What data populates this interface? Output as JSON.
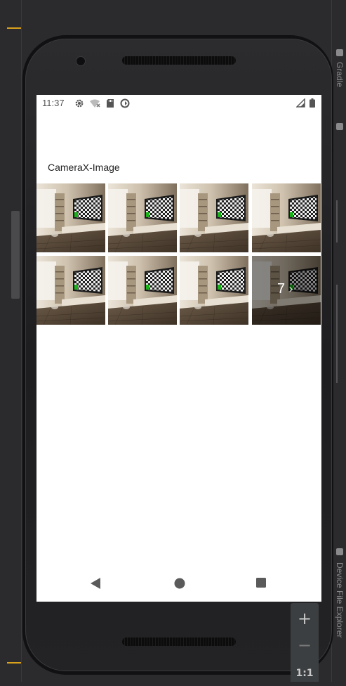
{
  "status_bar": {
    "time": "11:37",
    "left_icons": [
      "gear-icon",
      "wifi-off-icon",
      "sd-card-icon",
      "sync-icon"
    ],
    "right_icons": [
      "signal-icon",
      "battery-icon"
    ]
  },
  "app": {
    "title": "CameraX-Image"
  },
  "gallery": {
    "thumbnail_count": 8,
    "more_count": "7",
    "more_chevron": "›"
  },
  "nav_bar": {
    "buttons": [
      "back-icon",
      "home-icon",
      "recents-icon"
    ]
  },
  "ide": {
    "zoom_in_label": "+",
    "zoom_out_label": "−",
    "actual_size_label": "1:1",
    "right_panel_label_1": "Gradle",
    "right_panel_label_2": "Device File Explorer"
  },
  "colors": {
    "ide_background": "#2b2b2d",
    "ide_marker": "#d9a21b",
    "screen_background": "#ffffff",
    "phone_body": "#1e1e20"
  }
}
